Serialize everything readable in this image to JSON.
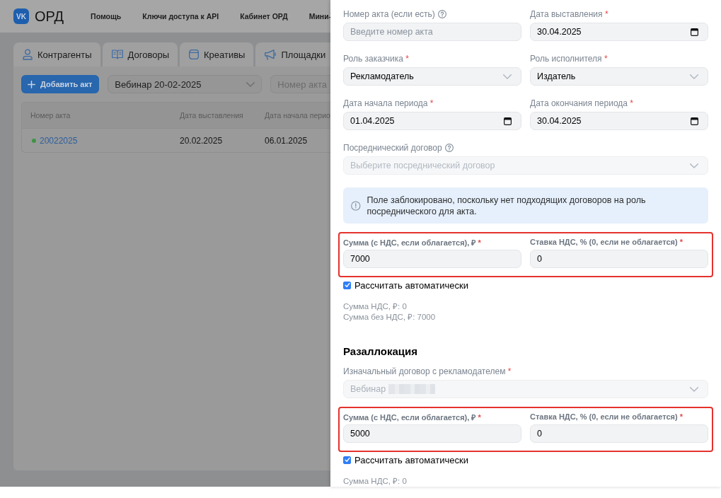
{
  "header": {
    "logo_mark": "VK",
    "logo_text": "ОРД",
    "nav": [
      {
        "label": "Помощь"
      },
      {
        "label": "Ключи доступа к API"
      },
      {
        "label": "Кабинет ОРД"
      },
      {
        "label": "Мини-"
      }
    ]
  },
  "tabs": [
    {
      "label": "Контрагенты",
      "selected": false
    },
    {
      "label": "Договоры",
      "selected": false
    },
    {
      "label": "Креативы",
      "selected": false
    },
    {
      "label": "Площадки",
      "selected": false
    }
  ],
  "toolbar": {
    "add_button": "Добавить акт",
    "contract_select": {
      "value": "Вебинар 20-02-2025"
    },
    "search": {
      "placeholder": "Номер акта"
    }
  },
  "table": {
    "columns": [
      "Номер акта",
      "Дата выставления",
      "Дата начала перио"
    ],
    "rows": [
      {
        "color": "#3f9444",
        "cells": [
          "20022025",
          "20.02.2025",
          "06.01.2025"
        ]
      }
    ]
  },
  "act_form": {
    "rows": [
      {
        "fields": [
          {
            "kind": "text",
            "label": "Номер акта (если есть)",
            "help": true,
            "placeholder": "Введите номер акта",
            "disabled": false,
            "redacted": false
          },
          {
            "kind": "date",
            "label": "Дата выставления",
            "required_mark": "*",
            "help": false,
            "value": "30.04.2025",
            "disabled": false,
            "redacted": false
          }
        ]
      },
      {
        "fields": [
          {
            "kind": "select",
            "label": "Роль заказчика",
            "required_mark": "*",
            "help": false,
            "value": "Рекламодатель",
            "disabled": false,
            "redacted": false
          },
          {
            "kind": "select",
            "label": "Роль исполнителя",
            "required_mark": "*",
            "help": false,
            "value": "Издатель",
            "disabled": false,
            "redacted": false
          }
        ]
      },
      {
        "fields": [
          {
            "kind": "date",
            "label": "Дата начала периода",
            "required_mark": "*",
            "help": false,
            "value": "01.04.2025",
            "disabled": false,
            "redacted": false
          },
          {
            "kind": "date",
            "label": "Дата окончания периода",
            "required_mark": "*",
            "help": false,
            "value": "30.04.2025",
            "disabled": false,
            "redacted": false
          }
        ]
      },
      {
        "fields": [
          {
            "kind": "select",
            "label": "Посреднический договор",
            "help": true,
            "placeholder": "Выберите посреднический договор",
            "disabled": true,
            "redacted": false
          }
        ]
      }
    ],
    "notice": "Поле заблокировано, поскольку нет подходящих договоров на роль посреднического для акта.",
    "amounts": {
      "highlighted": true,
      "fields": [
        {
          "kind": "text",
          "label": "Сумма (с НДС, если облагается), ₽",
          "required_mark": "*",
          "help": false,
          "value": "7000",
          "disabled": false,
          "redacted": false
        },
        {
          "kind": "text",
          "label": "Ставка НДС, % (0, если не облагается)",
          "required_mark": "*",
          "help": false,
          "value": "0",
          "disabled": false,
          "redacted": false
        }
      ]
    },
    "auto_calc": {
      "label": "Рассчитать автоматически",
      "checked": true
    },
    "summary": [
      "Сумма НДС, ₽: 0",
      "Сумма без НДС, ₽: 7000"
    ]
  },
  "reallocation": {
    "title": "Разаллокация",
    "rows": [
      {
        "fields": [
          {
            "kind": "select",
            "label": "Изначальный договор с рекламодателем",
            "required_mark": "*",
            "help": false,
            "value": "Вебинар",
            "disabled": true,
            "redacted": true
          }
        ]
      }
    ],
    "amounts": {
      "highlighted": true,
      "fields": [
        {
          "kind": "text",
          "label": "Сумма (с НДС, если облагается), ₽",
          "required_mark": "*",
          "help": false,
          "value": "5000",
          "disabled": false,
          "redacted": false
        },
        {
          "kind": "text",
          "label": "Ставка НДС, % (0, если не облагается)",
          "required_mark": "*",
          "help": false,
          "value": "0",
          "disabled": false,
          "redacted": false
        }
      ]
    },
    "auto_calc": {
      "label": "Рассчитать автоматически",
      "checked": true
    },
    "summary": [
      "Сумма НДС, ₽: 0"
    ]
  }
}
